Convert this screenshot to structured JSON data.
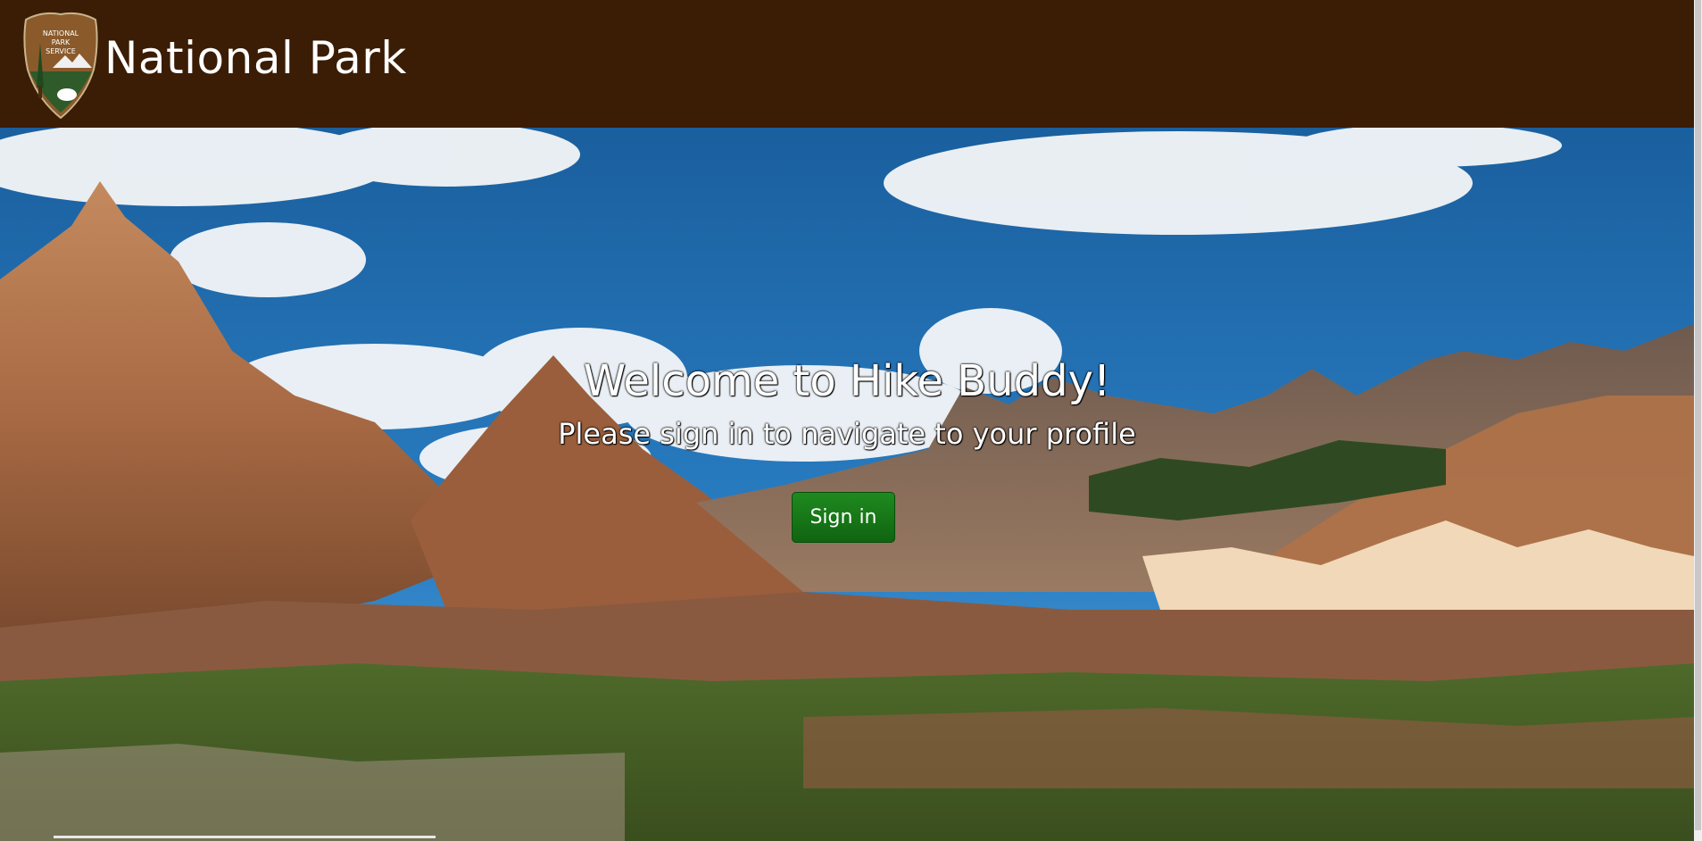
{
  "header": {
    "logo_icon": "nps-arrowhead-icon",
    "logo_text_line1": "NATIONAL",
    "logo_text_line2": "PARK",
    "logo_text_line3": "SERVICE",
    "title": "National Park",
    "background_color": "#3b1c04"
  },
  "hero": {
    "heading": "Welcome to Hike Buddy!",
    "subheading": "Please sign in to navigate to your profile",
    "signin_label": "Sign in",
    "signin_color": "#137a13",
    "image_subject": "badlands-landscape-image"
  }
}
